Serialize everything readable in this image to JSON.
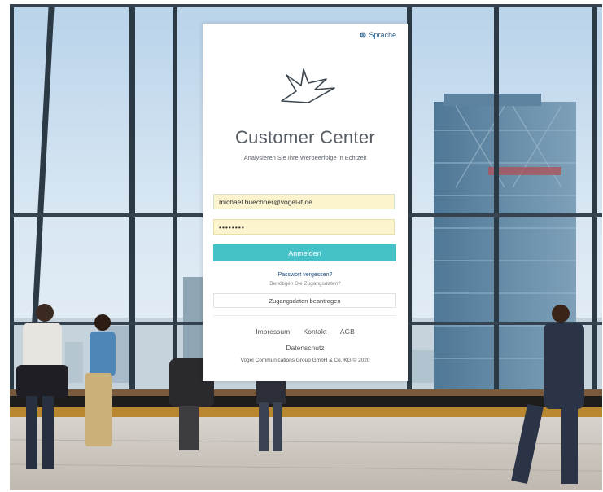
{
  "header": {
    "language_label": "Sprache"
  },
  "brand": {
    "title": "Customer Center",
    "subtitle": "Analysieren Sie Ihre Werbeerfolge in Echtzeit"
  },
  "login": {
    "email_value": "michael.buechner@vogel-it.de",
    "password_value": "••••••••",
    "submit_label": "Anmelden",
    "forgot_label": "Passwort vergessen?",
    "need_access_text": "Benötigen Sie Zugangsdaten?",
    "request_access_label": "Zugangsdaten beantragen"
  },
  "footer": {
    "links": [
      "Impressum",
      "Kontakt",
      "AGB"
    ],
    "privacy_label": "Datenschutz",
    "copyright": "Vogel Communications Group GmbH & Co. KG © 2020"
  },
  "colors": {
    "accent_button": "#45c1c8",
    "link_blue": "#1d4f86",
    "autofill_yellow": "#fbf4cf"
  }
}
